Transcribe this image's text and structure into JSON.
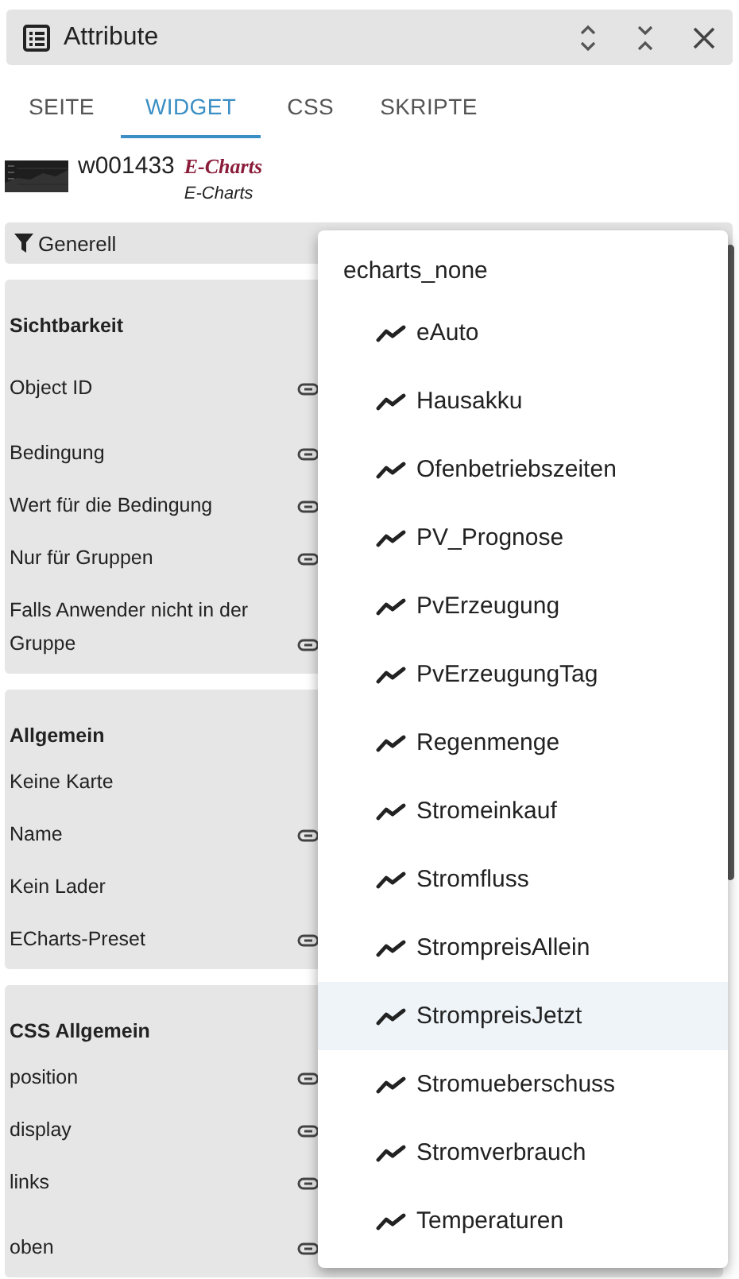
{
  "window": {
    "title": "Attribute"
  },
  "tabs": [
    {
      "label": "SEITE",
      "selected": false
    },
    {
      "label": "WIDGET",
      "selected": true
    },
    {
      "label": "CSS",
      "selected": false
    },
    {
      "label": "SKRIPTE",
      "selected": false
    }
  ],
  "widget": {
    "id": "w001433",
    "set": "E-Charts",
    "type": "E-Charts"
  },
  "filter": {
    "label": "Generell"
  },
  "groups": [
    {
      "title": "Sichtbarkeit",
      "rows": [
        {
          "label": "Object ID",
          "linked": true
        },
        {
          "label": "Bedingung",
          "linked": true
        },
        {
          "label": "Wert für die Bedingung",
          "linked": true
        },
        {
          "label": "Nur für Gruppen",
          "linked": true
        },
        {
          "label": "Falls Anwender nicht in der Gruppe",
          "linked": true
        }
      ]
    },
    {
      "title": "Allgemein",
      "rows": [
        {
          "label": "Keine Karte",
          "linked": false
        },
        {
          "label": "Name",
          "linked": true
        },
        {
          "label": "Kein Lader",
          "linked": false
        },
        {
          "label": "ECharts-Preset",
          "linked": true
        }
      ]
    },
    {
      "title": "CSS Allgemein",
      "rows": [
        {
          "label": "position",
          "linked": true
        },
        {
          "label": "display",
          "linked": true
        },
        {
          "label": "links",
          "linked": true
        },
        {
          "label": "oben",
          "linked": true
        }
      ]
    }
  ],
  "menu": {
    "header": "echarts_none",
    "items": [
      {
        "label": "eAuto",
        "selected": false
      },
      {
        "label": "Hausakku",
        "selected": false
      },
      {
        "label": "Ofenbetriebszeiten",
        "selected": false
      },
      {
        "label": "PV_Prognose",
        "selected": false
      },
      {
        "label": "PvErzeugung",
        "selected": false
      },
      {
        "label": "PvErzeugungTag",
        "selected": false
      },
      {
        "label": "Regenmenge",
        "selected": false
      },
      {
        "label": "Stromeinkauf",
        "selected": false
      },
      {
        "label": "Stromfluss",
        "selected": false
      },
      {
        "label": "StrompreisAllein",
        "selected": false
      },
      {
        "label": "StrompreisJetzt",
        "selected": true
      },
      {
        "label": "Stromueberschuss",
        "selected": false
      },
      {
        "label": "Stromverbrauch",
        "selected": false
      },
      {
        "label": "Temperaturen",
        "selected": false
      }
    ]
  }
}
